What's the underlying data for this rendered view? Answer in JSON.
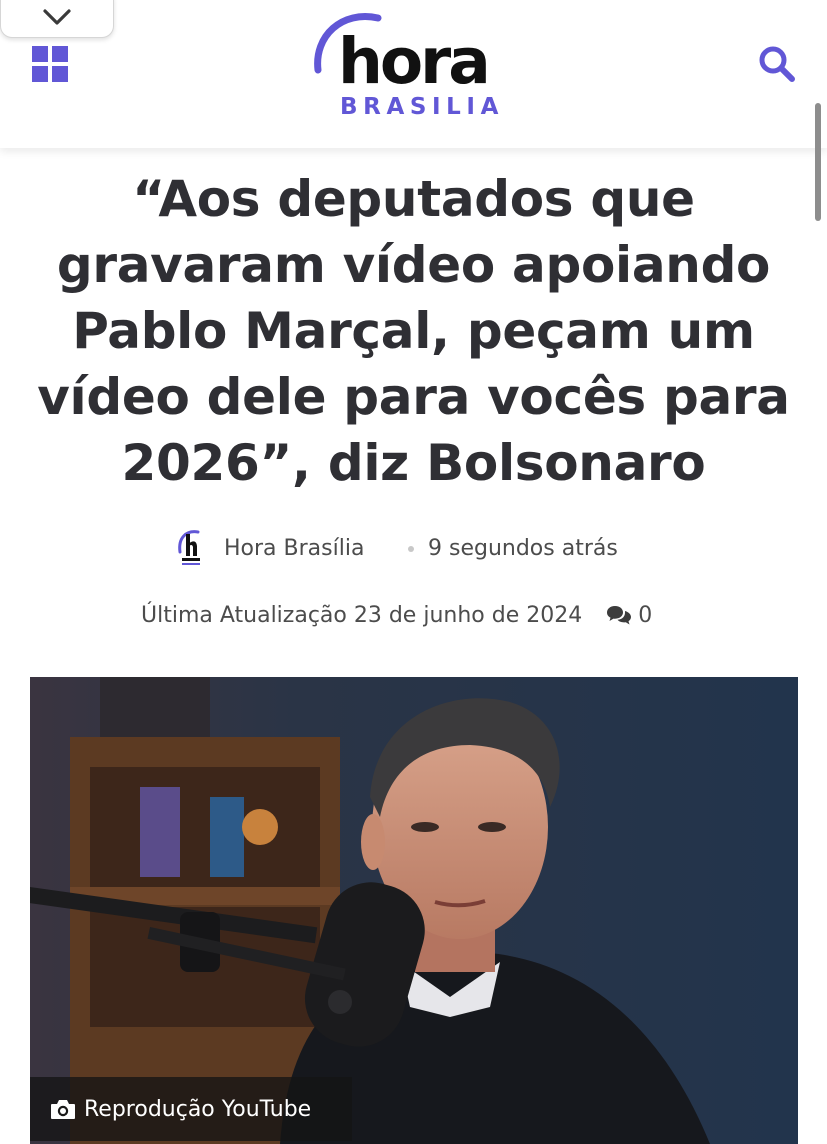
{
  "header": {
    "logo": {
      "word": "hora",
      "sub": "BRASILIA"
    },
    "menu_icon": "grid-icon",
    "search_icon": "search-icon",
    "collapse_icon": "chevron-down-icon",
    "accent_color": "#6157d6"
  },
  "article": {
    "title": "“Aos deputados que gravaram vídeo apoiando Pablo Marçal, peçam um vídeo dele para vocês para 2026”, diz Bolsonaro",
    "author": "Hora Brasília",
    "time_ago": "9 segundos atrás",
    "updated": "Última Atualização 23 de junho de 2024",
    "comment_count": "0",
    "image_caption": "Reprodução YouTube"
  }
}
